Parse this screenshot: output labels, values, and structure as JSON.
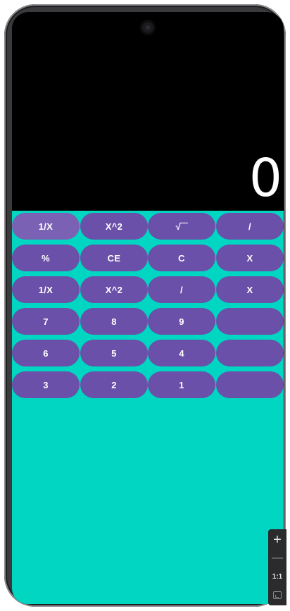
{
  "display": {
    "value": "0"
  },
  "keypad": {
    "rows": [
      [
        "1/X",
        "X^2",
        "√‾‾",
        "/"
      ],
      [
        "%",
        "CE",
        "C",
        "X"
      ],
      [
        "1/X",
        "X^2",
        "/",
        "X"
      ],
      [
        "7",
        "8",
        "9",
        ""
      ],
      [
        "6",
        "5",
        "4",
        ""
      ],
      [
        "3",
        "2",
        "1",
        ""
      ]
    ]
  },
  "zoom_controls": {
    "plus": "+",
    "minus": "—",
    "reset": "1:1",
    "fit_icon": "fit-screen-icon"
  },
  "colors": {
    "display_bg": "#000000",
    "keypad_bg": "#00d6c2",
    "key_bg": "#6a50a8",
    "key_text": "#ffffff"
  }
}
